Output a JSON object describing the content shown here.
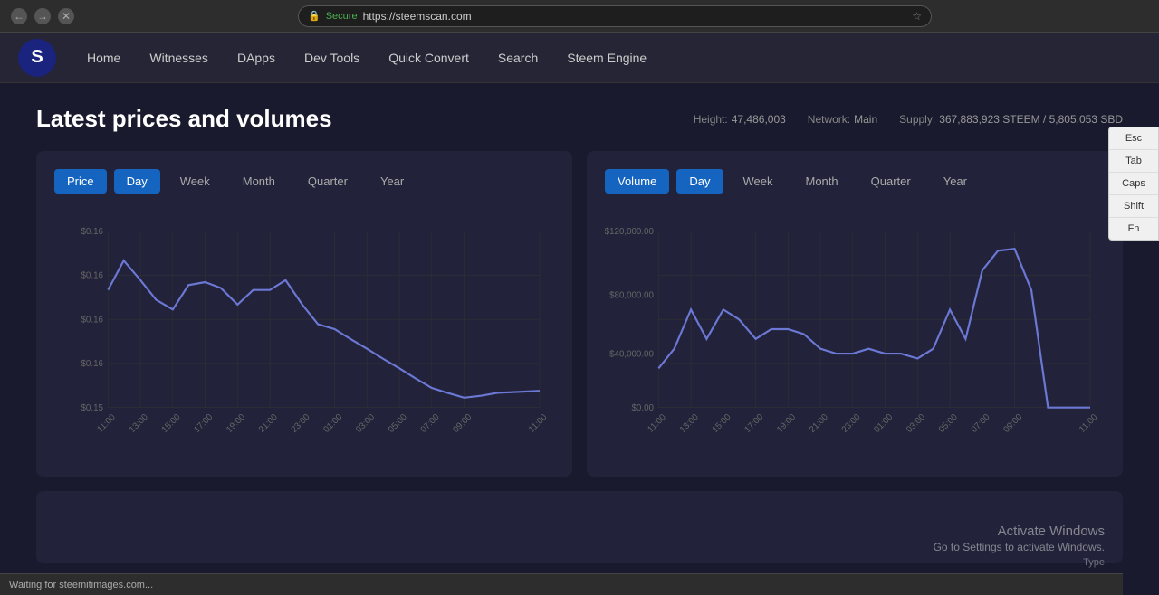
{
  "browser": {
    "url": "https://steemscan.com",
    "secure_label": "Secure"
  },
  "navbar": {
    "logo_text": "S",
    "links": [
      "Home",
      "Witnesses",
      "DApps",
      "Dev Tools",
      "Quick Convert",
      "Search",
      "Steem Engine"
    ]
  },
  "page": {
    "title": "Latest prices and volumes",
    "stats": {
      "height_label": "Height:",
      "height_value": "47,486,003",
      "network_label": "Network:",
      "network_value": "Main",
      "supply_label": "Supply:",
      "supply_value": "367,883,923 STEEM / 5,805,053 SBD"
    }
  },
  "price_chart": {
    "label_btn": "Price",
    "controls": [
      "Day",
      "Week",
      "Month",
      "Quarter",
      "Year"
    ],
    "active_control": "Day",
    "y_labels": [
      "$0.16",
      "$0.16",
      "$0.16",
      "$0.16",
      "$0.15"
    ],
    "x_labels": [
      "11:00",
      "13:00",
      "15:00",
      "17:00",
      "19:00",
      "21:00",
      "23:00",
      "01:00",
      "03:00",
      "05:00",
      "07:00",
      "09:00",
      "11:00"
    ]
  },
  "volume_chart": {
    "label_btn": "Volume",
    "controls": [
      "Day",
      "Week",
      "Month",
      "Quarter",
      "Year"
    ],
    "active_control": "Day",
    "y_labels": [
      "$120,000.00",
      "$80,000.00",
      "$40,000.00",
      "$0.00"
    ],
    "x_labels": [
      "11:00",
      "13:00",
      "15:00",
      "17:00",
      "19:00",
      "21:00",
      "23:00",
      "01:00",
      "03:00",
      "05:00",
      "07:00",
      "09:00",
      "11:00"
    ]
  },
  "keyboard": {
    "keys": [
      "Esc",
      "Tab",
      "Caps",
      "Shift",
      "Fn"
    ]
  },
  "status_bar": {
    "text": "Waiting for steemitimages.com..."
  },
  "activate_windows": {
    "title": "Activate Windows",
    "sub": "Go to Settings to activate Windows.",
    "type": "Type"
  }
}
